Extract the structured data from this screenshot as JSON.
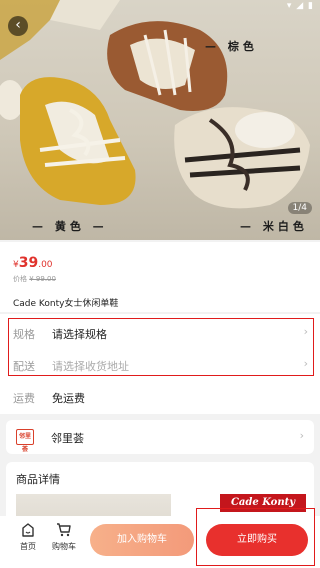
{
  "status_bar": {
    "icons": "▾ ◢ ▮"
  },
  "hero": {
    "label_brown": "— 棕色",
    "label_yellow": "— 黄色 —",
    "label_white": "— 米白色 —",
    "counter": "1/4"
  },
  "product": {
    "currency": "¥",
    "price_int": "39",
    "price_dec": ".00",
    "orig_label": "价格",
    "orig_price": "¥ 99.00",
    "title": "Cade Konty女士休闲单鞋"
  },
  "spec": {
    "spec_key": "规格",
    "spec_value": "请选择规格",
    "addr_key": "配送",
    "addr_value": "请选择收货地址",
    "ship_key": "运费",
    "ship_value": "免运费"
  },
  "store": {
    "icon_text": "邻里荟",
    "name": "邻里荟"
  },
  "details": {
    "title": "商品详情",
    "banner_text": "Cade Konty"
  },
  "bottom": {
    "home": "首页",
    "cart": "购物车",
    "add_to_cart": "加入购物车",
    "buy_now": "立即购买"
  },
  "colors": {
    "price": "#e0322c",
    "buy": "#e8302d",
    "add": "#f39a7a",
    "highlight": "#e01b1b"
  }
}
